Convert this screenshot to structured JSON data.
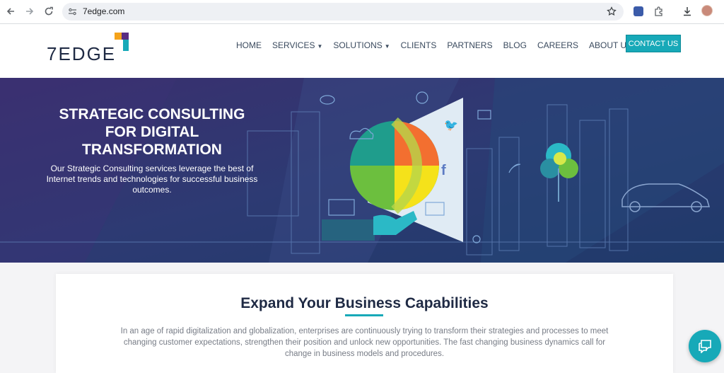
{
  "browser": {
    "url": "7edge.com",
    "icons": [
      "back-icon",
      "forward-icon",
      "reload-icon",
      "site-settings-icon",
      "star-icon",
      "extension-icon",
      "puzzle-icon",
      "download-icon",
      "profile-avatar"
    ]
  },
  "header": {
    "logo_text": "7EDGE",
    "nav": [
      {
        "label": "HOME",
        "has_caret": false
      },
      {
        "label": "SERVICES",
        "has_caret": true
      },
      {
        "label": "SOLUTIONS",
        "has_caret": true
      },
      {
        "label": "CLIENTS",
        "has_caret": false
      },
      {
        "label": "PARTNERS",
        "has_caret": false
      },
      {
        "label": "BLOG",
        "has_caret": false
      },
      {
        "label": "CAREERS",
        "has_caret": false
      },
      {
        "label": "ABOUT US",
        "has_caret": true
      }
    ],
    "contact_label": "CONTACT US"
  },
  "hero": {
    "title": "STRATEGIC CONSULTING FOR DIGITAL TRANSFORMATION",
    "subtitle": "Our Strategic Consulting services leverage the best of Internet trends and technologies for successful business outcomes."
  },
  "section": {
    "title": "Expand Your Business Capabilities",
    "body": "In an age of rapid digitalization and globalization, enterprises are continuously trying to transform their strategies and processes to meet changing customer expectations, strengthen their position and unlock new opportunities. The fast changing business dynamics call for change in business models and procedures."
  },
  "colors": {
    "accent": "#17a9b8",
    "hero_bg": "#2d3670",
    "logo_orange": "#f5a31a",
    "logo_purple": "#5a2d82",
    "text_dark": "#1f2a44"
  }
}
